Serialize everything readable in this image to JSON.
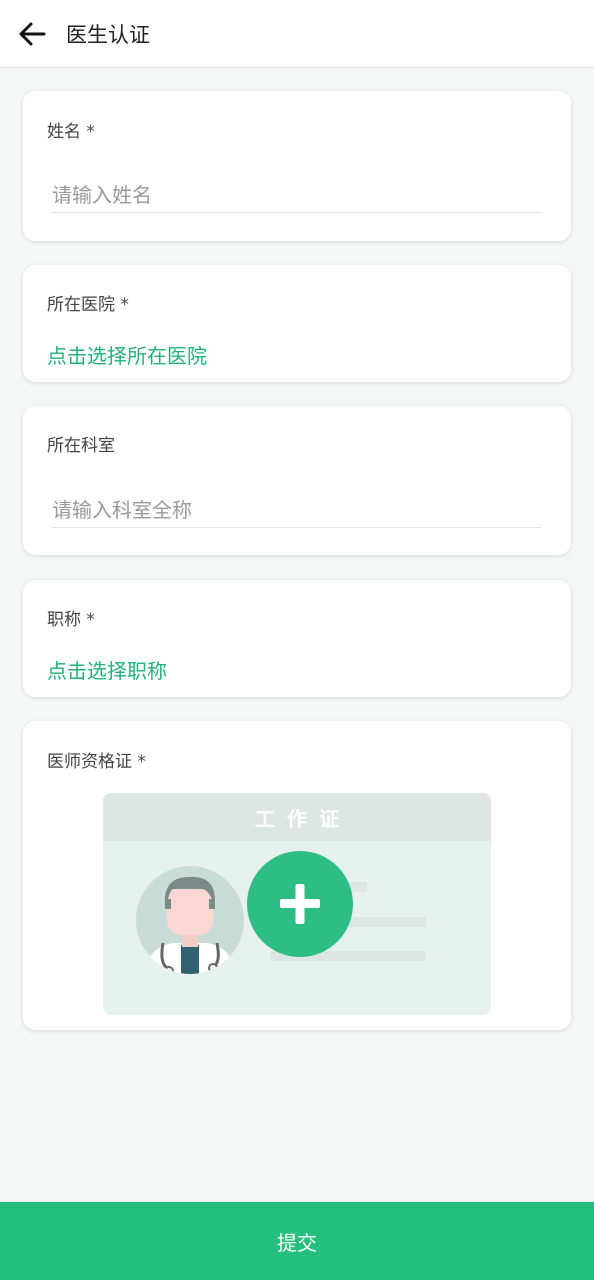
{
  "header": {
    "title": "医生认证",
    "back_icon": "arrow-left-icon"
  },
  "form": {
    "name": {
      "label": "姓名 *",
      "placeholder": "请输入姓名",
      "value": ""
    },
    "hospital": {
      "label": "所在医院 *",
      "picker_text": "点击选择所在医院"
    },
    "department": {
      "label": "所在科室",
      "placeholder": "请输入科室全称",
      "value": ""
    },
    "title": {
      "label": "职称 *",
      "picker_text": "点击选择职称"
    },
    "certificate": {
      "label": "医师资格证 *",
      "card_heading": "工作证",
      "upload_icon": "plus-circle-icon"
    }
  },
  "submit": {
    "label": "提交"
  },
  "colors": {
    "accent": "#22b277",
    "submit_bg": "#22bf7d",
    "upload_circle": "#2ebd85",
    "page_bg": "#f5f6f6"
  }
}
